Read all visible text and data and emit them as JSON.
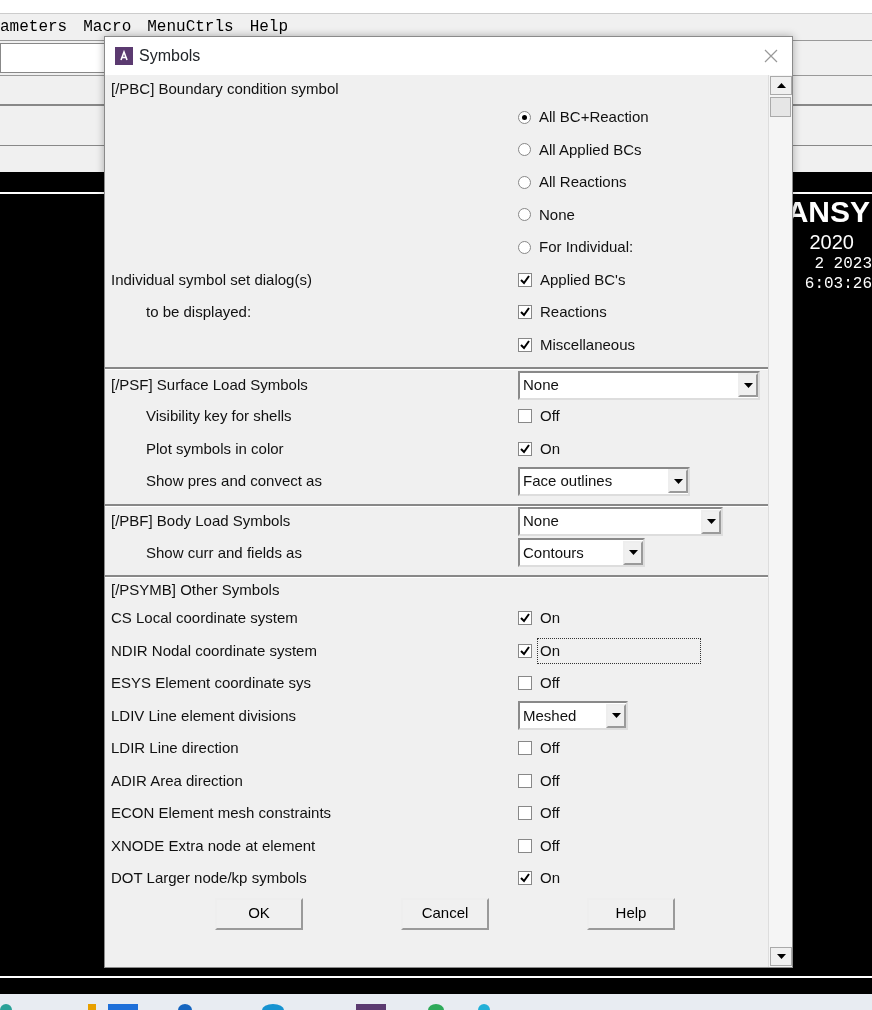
{
  "app": {
    "menu": [
      "ameters",
      "Macro",
      "MenuCtrls",
      "Help"
    ],
    "logo_text": "ANSY",
    "version": "2020",
    "date": "2 2023",
    "time": "6:03:26"
  },
  "dialog": {
    "title": "Symbols",
    "sections": [
      {
        "kind": "flat",
        "title": "[/PBC] Boundary condition symbol",
        "rows": [
          {
            "kind": "radio",
            "text": "All BC+Reaction",
            "selected": true
          },
          {
            "kind": "radio",
            "text": "All Applied BCs",
            "selected": false
          },
          {
            "kind": "radio",
            "text": "All Reactions",
            "selected": false
          },
          {
            "kind": "radio",
            "text": "None",
            "selected": false
          },
          {
            "kind": "radio",
            "text": "For Individual:",
            "selected": false
          },
          {
            "kind": "checkbox",
            "label": "Individual symbol set dialog(s)",
            "text": "Applied BC's",
            "checked": true
          },
          {
            "kind": "checkbox",
            "label": "to be displayed:",
            "text": "Reactions",
            "checked": true
          },
          {
            "kind": "checkbox",
            "text": "Miscellaneous",
            "checked": true
          }
        ]
      },
      {
        "kind": "indented",
        "title": "[/PSF]  Surface Load Symbols",
        "title_select": "None",
        "rows": [
          {
            "kind": "checkbox",
            "label": "Visibility key for shells",
            "text": "Off",
            "checked": false
          },
          {
            "kind": "checkbox",
            "label": "Plot symbols in color",
            "text": "On",
            "checked": true
          },
          {
            "kind": "select",
            "label": "Show pres and convect as",
            "text": "Face outlines"
          }
        ]
      },
      {
        "kind": "indented",
        "title": "[/PBF]  Body Load Symbols",
        "title_select": "None",
        "rows": [
          {
            "kind": "select",
            "label": "Show curr and fields as",
            "text": "Contours"
          }
        ]
      },
      {
        "kind": "flat",
        "title": "[/PSYMB] Other Symbols",
        "rows": [
          {
            "kind": "checkbox",
            "label": "CS   Local coordinate system",
            "text": "On",
            "checked": true,
            "focused": false
          },
          {
            "kind": "checkbox",
            "label": "NDIR Nodal coordinate system",
            "text": "On",
            "checked": true,
            "focused": true
          },
          {
            "kind": "checkbox",
            "label": "ESYS Element coordinate sys",
            "text": "Off",
            "checked": false,
            "focused": false
          },
          {
            "kind": "select",
            "label": "LDIV  Line element divisions",
            "text": "Meshed"
          },
          {
            "kind": "checkbox",
            "label": "LDIR Line direction",
            "text": "Off",
            "checked": false,
            "focused": false
          },
          {
            "kind": "checkbox",
            "label": "ADIR Area direction",
            "text": "Off",
            "checked": false,
            "focused": false
          },
          {
            "kind": "checkbox",
            "label": "ECON Element mesh constraints",
            "text": "Off",
            "checked": false,
            "focused": false
          },
          {
            "kind": "checkbox",
            "label": "XNODE Extra node at element",
            "text": "Off",
            "checked": false,
            "focused": false
          },
          {
            "kind": "checkbox",
            "label": "DOT  Larger node/kp symbols",
            "text": "On",
            "checked": true,
            "focused": false
          }
        ]
      }
    ],
    "buttons": [
      "OK",
      "Cancel",
      "Help"
    ]
  }
}
